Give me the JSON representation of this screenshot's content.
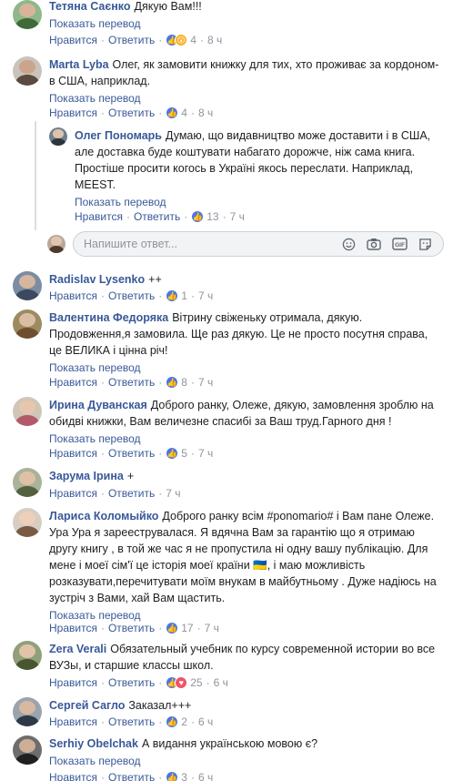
{
  "ui": {
    "translate": "Показать перевод",
    "like": "Нравится",
    "reply": "Ответить",
    "reply_placeholder": "Напишите ответ...",
    "dot": "·",
    "icons": [
      "emoji-icon",
      "camera-icon",
      "gif-icon",
      "sticker-icon"
    ]
  },
  "comments": [
    {
      "author": "Тетяна Саєнко",
      "text": "Дякую Вам!!!",
      "reactions": [
        "like",
        "wow"
      ],
      "count": "4",
      "time": "8 ч",
      "translate": true
    },
    {
      "author": "Marta Lyba",
      "text": "Олег, як замовити книжку для тих, хто проживає за кордоном- в США, наприклад.",
      "reactions": [
        "like"
      ],
      "count": "4",
      "time": "8 ч",
      "translate": true
    },
    {
      "author": "Олег Пономарь",
      "text": "Думаю, що видавництво може доставити і в США, але доставка буде коштувати набагато дорожче, ніж сама книга. Простіше просити когось в Україні якось переслати. Наприклад, MEEST.",
      "reactions": [
        "like"
      ],
      "count": "13",
      "time": "7 ч",
      "translate": true,
      "is_reply": true
    },
    {
      "author": "Radislav Lysenko",
      "text": "++",
      "reactions": [
        "like"
      ],
      "count": "1",
      "time": "7 ч",
      "translate": false
    },
    {
      "author": "Валентина Федоряка",
      "text": "Вітрину свіженьку отримала, дякую. Продовження,я замовила. Ще раз дякую. Це не просто посутня справа, це ВЕЛИКА і цінна річ!",
      "reactions": [
        "like"
      ],
      "count": "8",
      "time": "7 ч",
      "translate": true
    },
    {
      "author": "Ирина Дуванская",
      "text": "Доброго ранку, Олеже, дякую, замовлення зроблю на обидві книжки, Вам величезне спасибі за Ваш труд.Гарного дня !",
      "reactions": [
        "like"
      ],
      "count": "5",
      "time": "7 ч",
      "translate": true
    },
    {
      "author": "Зарума Ірина",
      "text": "+",
      "reactions": [],
      "count": "",
      "time": "7 ч",
      "translate": false
    },
    {
      "author": "Лариса Коломыйко",
      "text": "Доброго ранку всім #ponomario# і Вам пане Олеже. Ура Ура я зарееструвалася. Я вдячна Вам за гарантію що я отримаю другу книгу , в той же час я не пропустила ні одну вашу публікацію. Для мене і моеї сім'ї це історія моеї країни 🇺🇦, і маю можливість розказувати,перечитувати моїм внукам в майбутньому . Дуже надіюсь на зустріч з Вами, хай Вам щастить.",
      "reactions": [
        "like"
      ],
      "count": "17",
      "time": "7 ч",
      "translate": true
    },
    {
      "author": "Zera Verali",
      "text": "Обязательный учебник по курсу современной истории во все ВУЗы, и старшие классы школ.",
      "reactions": [
        "like",
        "love"
      ],
      "count": "25",
      "time": "6 ч",
      "translate": false
    },
    {
      "author": "Сергей Сагло",
      "text": "Заказал+++",
      "reactions": [
        "like"
      ],
      "count": "2",
      "time": "6 ч",
      "translate": false
    },
    {
      "author": "Serhiy Obelchak",
      "text": "А видання українською мовою є?",
      "reactions": [
        "like"
      ],
      "count": "3",
      "time": "6 ч",
      "translate": true
    }
  ],
  "colors": {
    "link": "#385898",
    "meta": "#90949c",
    "like": "#4a76e8",
    "wow": "#f7b125",
    "love": "#f25268"
  }
}
